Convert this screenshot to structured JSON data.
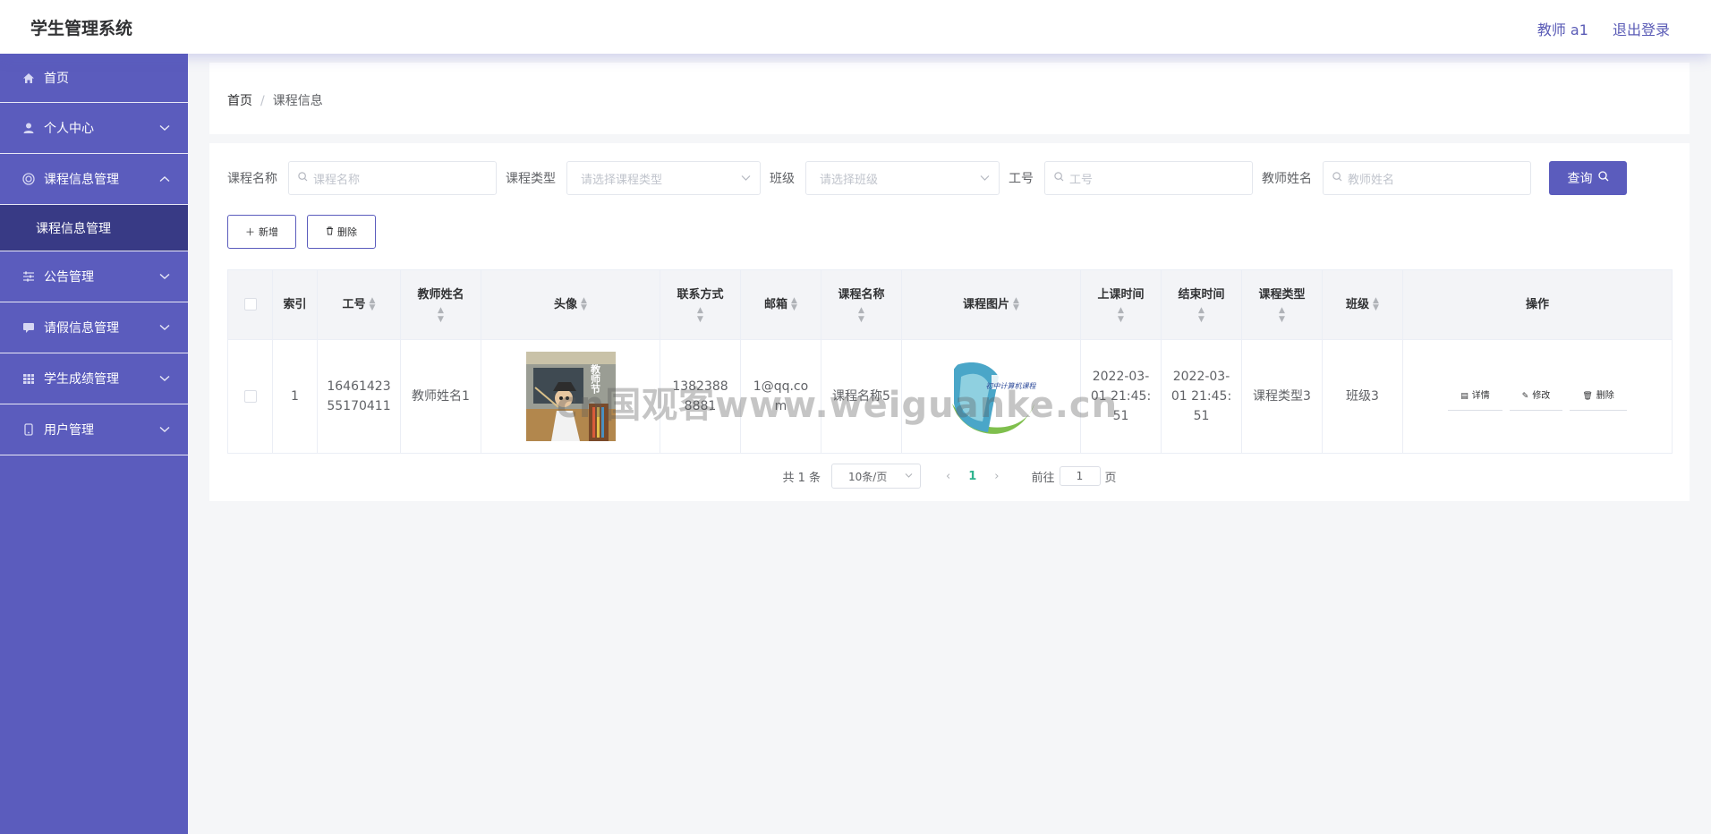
{
  "header": {
    "title": "学生管理系统",
    "user": "教师 a1",
    "logout": "退出登录"
  },
  "sidebar": {
    "items": [
      {
        "label": "首页",
        "icon": "home-icon"
      },
      {
        "label": "个人中心",
        "icon": "user-icon"
      },
      {
        "label": "课程信息管理",
        "icon": "book-icon",
        "expanded": true
      },
      {
        "label": "公告管理",
        "icon": "sliders-icon"
      },
      {
        "label": "请假信息管理",
        "icon": "message-icon"
      },
      {
        "label": "学生成绩管理",
        "icon": "grid-icon"
      },
      {
        "label": "用户管理",
        "icon": "phone-icon"
      }
    ],
    "submenu": {
      "label": "课程信息管理"
    }
  },
  "breadcrumb": {
    "home": "首页",
    "separator": "/",
    "current": "课程信息"
  },
  "search": {
    "course_name_label": "课程名称",
    "course_name_placeholder": "课程名称",
    "course_type_label": "课程类型",
    "course_type_placeholder": "请选择课程类型",
    "class_label": "班级",
    "class_placeholder": "请选择班级",
    "job_no_label": "工号",
    "job_no_placeholder": "工号",
    "teacher_name_label": "教师姓名",
    "teacher_name_placeholder": "教师姓名",
    "query_button": "查询"
  },
  "actions": {
    "add": "新增",
    "delete": "删除"
  },
  "table": {
    "headers": {
      "index": "索引",
      "job_no": "工号",
      "teacher_name": "教师姓名",
      "avatar": "头像",
      "contact": "联系方式",
      "email": "邮箱",
      "course_name": "课程名称",
      "course_image": "课程图片",
      "start_time": "上课时间",
      "end_time": "结束时间",
      "course_type": "课程类型",
      "class": "班级",
      "operation": "操作"
    },
    "rows": [
      {
        "index": "1",
        "job_no": "1646142355170411",
        "teacher_name": "教师姓名1",
        "contact": "13823888881",
        "email": "1@qq.com",
        "course_name": "课程名称5",
        "start_time": "2022-03-01 21:45:51",
        "end_time": "2022-03-01 21:45:51",
        "course_type": "课程类型3",
        "class": "班级3",
        "row_actions": {
          "detail": "详情",
          "edit": "修改",
          "delete": "删除"
        }
      }
    ]
  },
  "pagination": {
    "total": "共 1 条",
    "page_size": "10条/页",
    "current_page": "1",
    "goto_prefix": "前往",
    "goto_value": "1",
    "goto_suffix": "页"
  },
  "images": {
    "avatar_caption": "教师节",
    "course_image_caption": "初中计算机课程"
  },
  "watermark": "cn国观客www.weiguanke.cn",
  "colors": {
    "primary": "#5b5cbd",
    "submenu_active": "#383a85",
    "page_bg": "#f5f6f8",
    "pager_active": "#2fb38e"
  }
}
